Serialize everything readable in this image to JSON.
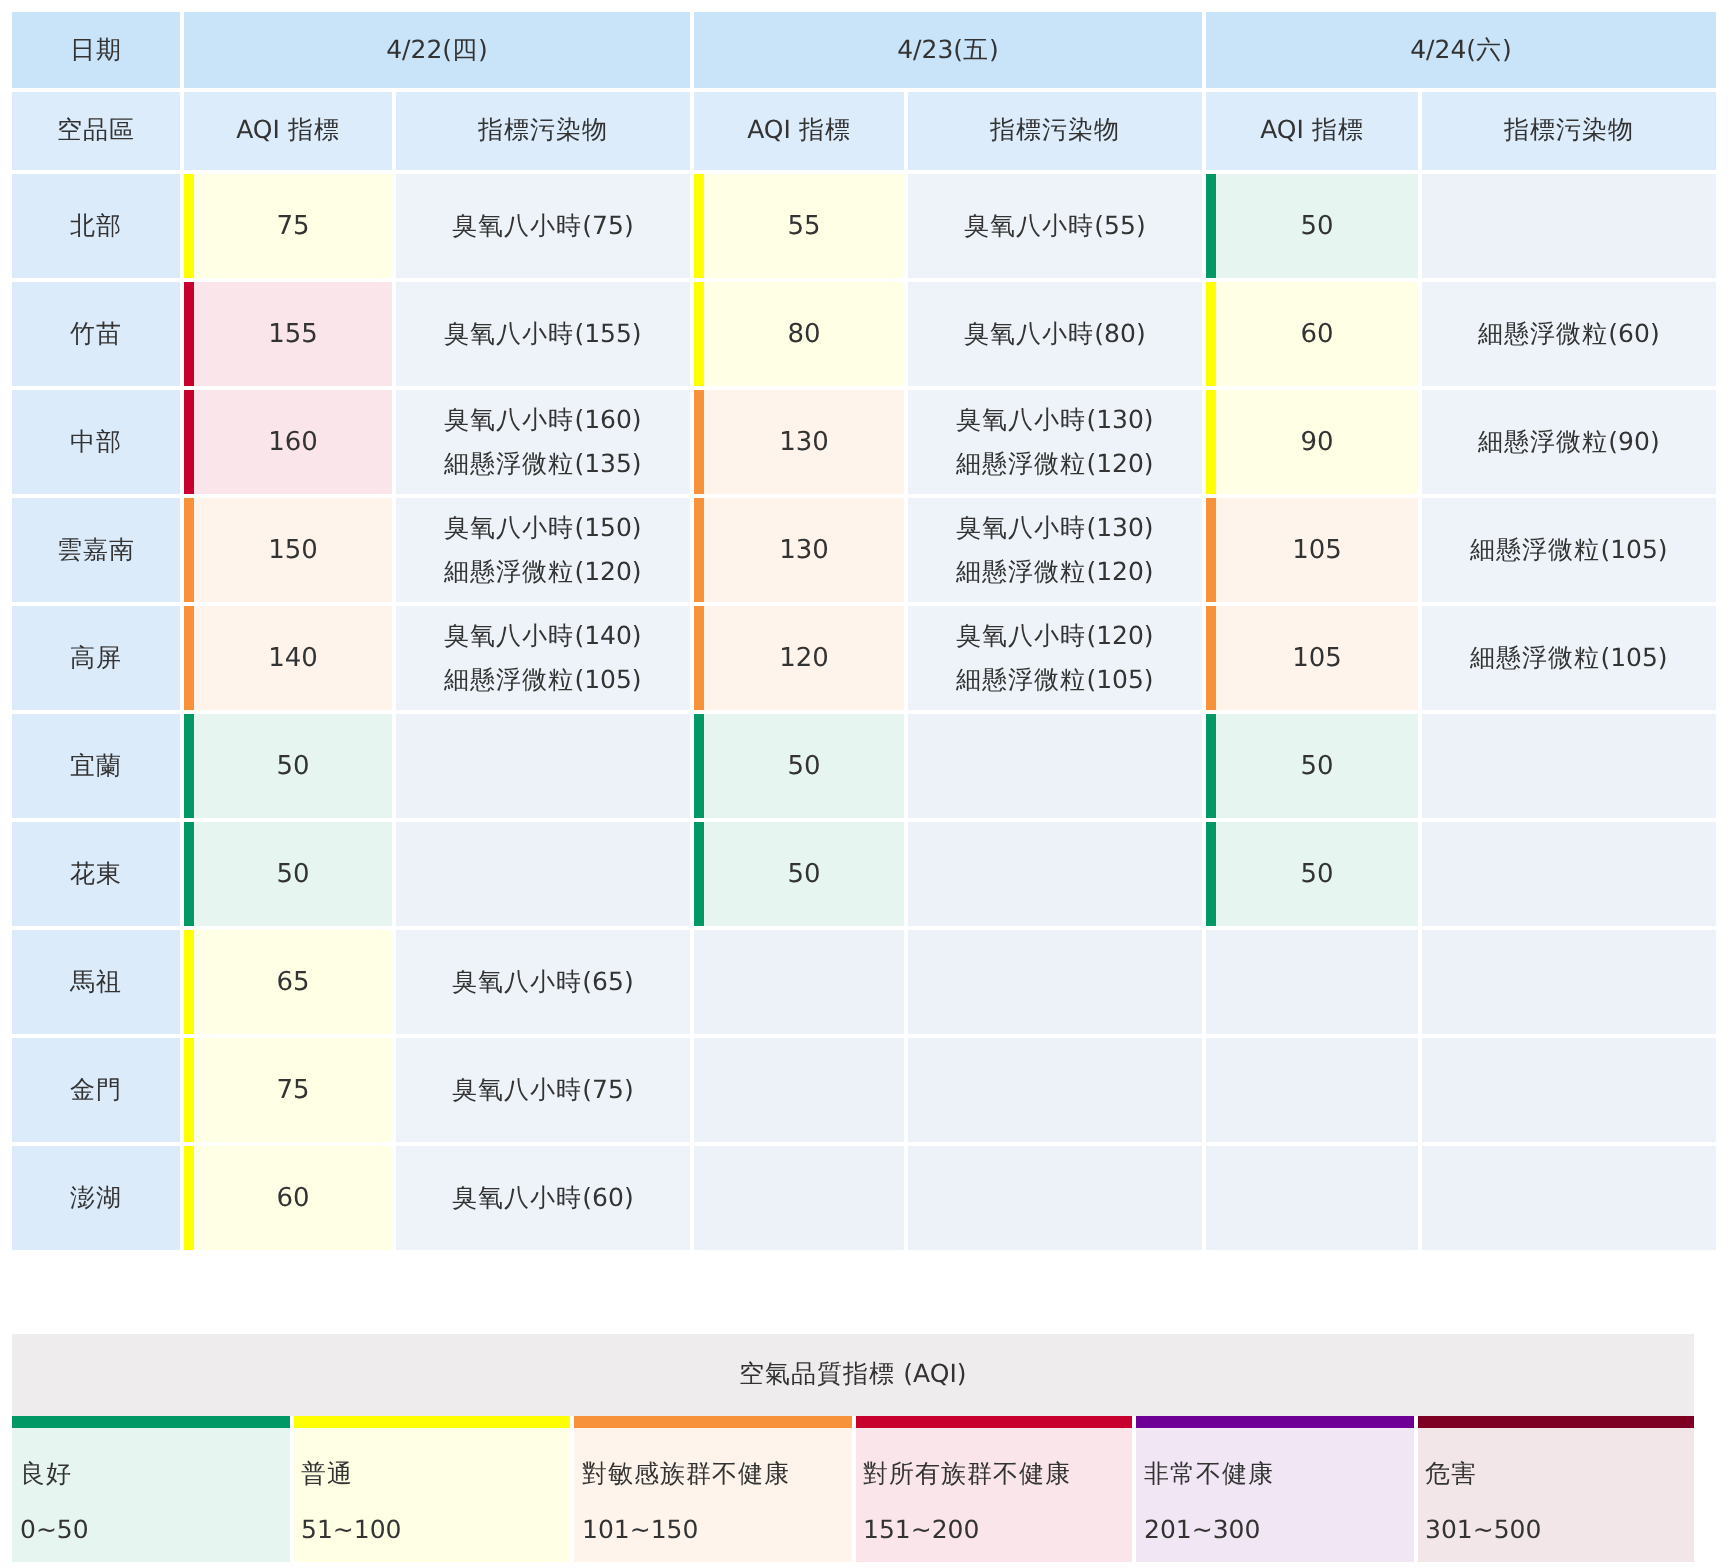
{
  "header": {
    "date_label": "日期",
    "region_label": "空品區",
    "days": [
      {
        "date": "4/22(四)",
        "aqi_label": "AQI 指標",
        "pollutant_label": "指標污染物"
      },
      {
        "date": "4/23(五)",
        "aqi_label": "AQI 指標",
        "pollutant_label": "指標污染物"
      },
      {
        "date": "4/24(六)",
        "aqi_label": "AQI 指標",
        "pollutant_label": "指標污染物"
      }
    ]
  },
  "rows": [
    {
      "region": "北部",
      "days": [
        {
          "aqi": "75",
          "color": "#ffff00",
          "pollutants": [
            "臭氧八小時(75)"
          ]
        },
        {
          "aqi": "55",
          "color": "#ffff00",
          "pollutants": [
            "臭氧八小時(55)"
          ]
        },
        {
          "aqi": "50",
          "color": "#009865"
        }
      ]
    },
    {
      "region": "竹苗",
      "days": [
        {
          "aqi": "155",
          "color": "#c8002d",
          "pollutants": [
            "臭氧八小時(155)"
          ]
        },
        {
          "aqi": "80",
          "color": "#ffff00",
          "pollutants": [
            "臭氧八小時(80)"
          ]
        },
        {
          "aqi": "60",
          "color": "#ffff00",
          "pollutants": [
            "細懸浮微粒(60)"
          ]
        }
      ]
    },
    {
      "region": "中部",
      "days": [
        {
          "aqi": "160",
          "color": "#c8002d",
          "pollutants": [
            "臭氧八小時(160)",
            "細懸浮微粒(135)"
          ]
        },
        {
          "aqi": "130",
          "color": "#f7913a",
          "pollutants": [
            "臭氧八小時(130)",
            "細懸浮微粒(120)"
          ]
        },
        {
          "aqi": "90",
          "color": "#ffff00",
          "pollutants": [
            "細懸浮微粒(90)"
          ]
        }
      ]
    },
    {
      "region": "雲嘉南",
      "days": [
        {
          "aqi": "150",
          "color": "#f7913a",
          "pollutants": [
            "臭氧八小時(150)",
            "細懸浮微粒(120)"
          ]
        },
        {
          "aqi": "130",
          "color": "#f7913a",
          "pollutants": [
            "臭氧八小時(130)",
            "細懸浮微粒(120)"
          ]
        },
        {
          "aqi": "105",
          "color": "#f7913a",
          "pollutants": [
            "細懸浮微粒(105)"
          ]
        }
      ]
    },
    {
      "region": "高屏",
      "days": [
        {
          "aqi": "140",
          "color": "#f7913a",
          "pollutants": [
            "臭氧八小時(140)",
            "細懸浮微粒(105)"
          ]
        },
        {
          "aqi": "120",
          "color": "#f7913a",
          "pollutants": [
            "臭氧八小時(120)",
            "細懸浮微粒(105)"
          ]
        },
        {
          "aqi": "105",
          "color": "#f7913a",
          "pollutants": [
            "細懸浮微粒(105)"
          ]
        }
      ]
    },
    {
      "region": "宜蘭",
      "days": [
        {
          "aqi": "50",
          "color": "#009865"
        },
        {
          "aqi": "50",
          "color": "#009865"
        },
        {
          "aqi": "50",
          "color": "#009865"
        }
      ]
    },
    {
      "region": "花東",
      "days": [
        {
          "aqi": "50",
          "color": "#009865"
        },
        {
          "aqi": "50",
          "color": "#009865"
        },
        {
          "aqi": "50",
          "color": "#009865"
        }
      ]
    },
    {
      "region": "馬祖",
      "days": [
        {
          "aqi": "65",
          "color": "#ffff00",
          "pollutants": [
            "臭氧八小時(65)"
          ]
        }
      ]
    },
    {
      "region": "金門",
      "days": [
        {
          "aqi": "75",
          "color": "#ffff00",
          "pollutants": [
            "臭氧八小時(75)"
          ]
        }
      ]
    },
    {
      "region": "澎湖",
      "days": [
        {
          "aqi": "60",
          "color": "#ffff00",
          "pollutants": [
            "臭氧八小時(60)"
          ]
        }
      ]
    }
  ],
  "legend": {
    "title": "空氣品質指標 (AQI)",
    "levels": [
      {
        "name": "良好",
        "range": "0~50",
        "color": "#009865"
      },
      {
        "name": "普通",
        "range": "51~100",
        "color": "#ffff00"
      },
      {
        "name": "對敏感族群不健康",
        "range": "101~150",
        "color": "#f7913a"
      },
      {
        "name": "對所有族群不健康",
        "range": "151~200",
        "color": "#c8002d"
      },
      {
        "name": "非常不健康",
        "range": "201~300",
        "color": "#6e0095"
      },
      {
        "name": "危害",
        "range": "301~500",
        "color": "#7e0023"
      }
    ]
  }
}
